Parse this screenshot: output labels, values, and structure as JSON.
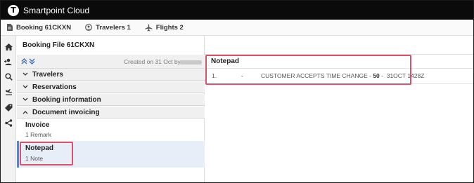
{
  "app": {
    "logo_letter": "T",
    "title": "Smartpoint Cloud"
  },
  "tabs": [
    {
      "icon": "document-icon",
      "label": "Booking 61CKXN"
    },
    {
      "icon": "user-icon",
      "label": "Travelers 1"
    },
    {
      "icon": "plane-icon",
      "label": "Flights 2"
    }
  ],
  "sidenav": [
    "home-icon",
    "add-user-icon",
    "search-icon",
    "flight-list-icon",
    "tag-icon",
    "share-icon"
  ],
  "booking_file": {
    "title": "Booking File 61CKXN",
    "created_label": "Created on 31 Oct by"
  },
  "sections": [
    {
      "label": "Travelers",
      "expanded": false
    },
    {
      "label": "Reservations",
      "expanded": false
    },
    {
      "label": "Booking information",
      "expanded": false
    },
    {
      "label": "Document invoicing",
      "expanded": true
    }
  ],
  "invoice": {
    "title": "Invoice",
    "subtitle": "1 Remark"
  },
  "notepad_item": {
    "title": "Notepad",
    "subtitle": "1 Note",
    "selected": true
  },
  "notepad_panel": {
    "title": "Notepad",
    "rows": [
      {
        "index": "1.",
        "dash": "-",
        "text": "CUSTOMER ACCEPTS TIME CHANGE - ",
        "code": "50",
        "rest": " -  31OCT 1428Z"
      }
    ]
  },
  "colors": {
    "topbar": "#0b0b0b",
    "highlight": "#d9516a",
    "selected_bg": "#e8eef8",
    "selected_border": "#5b86c5"
  }
}
